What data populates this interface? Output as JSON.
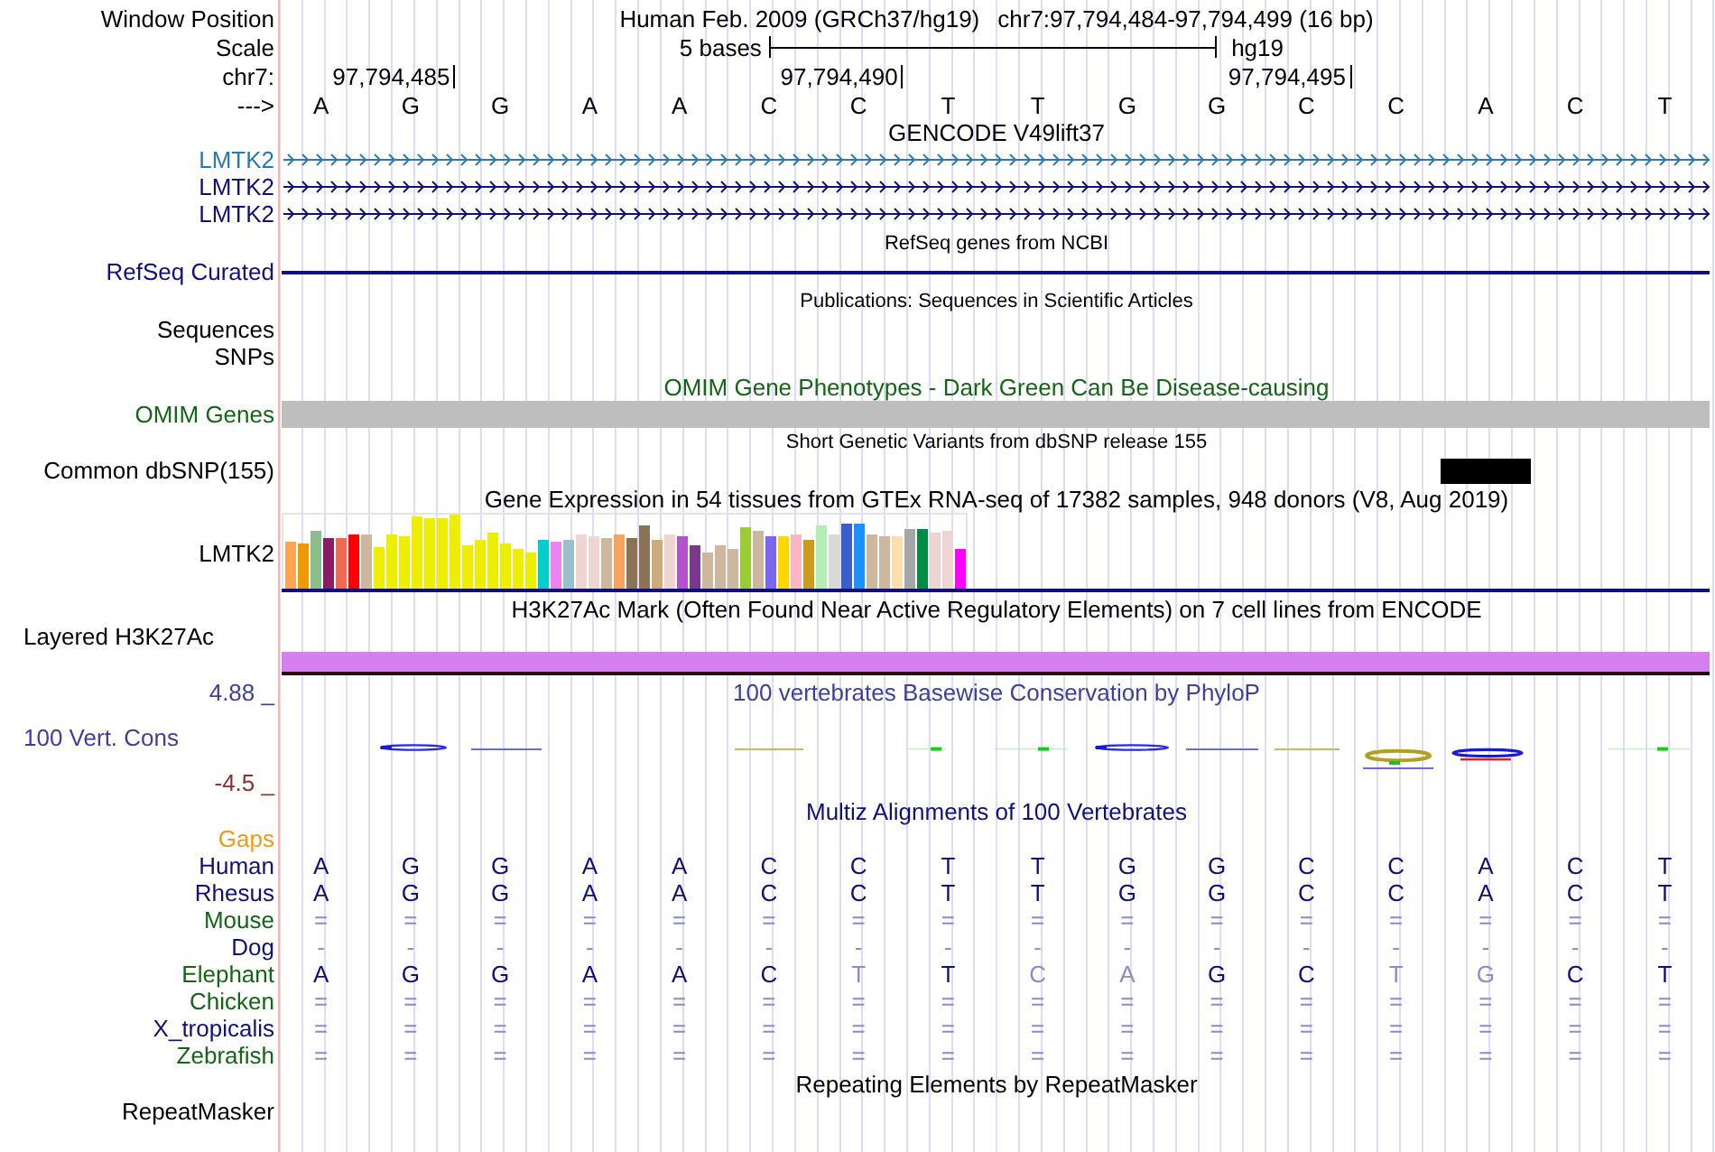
{
  "header": {
    "position_label": "Window Position",
    "assembly": "Human Feb. 2009 (GRCh37/hg19)",
    "position": "chr7:97,794,484-97,794,499 (16 bp)",
    "scale_label": "Scale",
    "scale_length": "5 bases",
    "scale_assembly": "hg19",
    "chrom_label": "chr7:",
    "strand_label": "--->"
  },
  "bases": [
    {
      "letter": "A"
    },
    {
      "letter": "G",
      "tick": "97,794,485"
    },
    {
      "letter": "G"
    },
    {
      "letter": "A"
    },
    {
      "letter": "A"
    },
    {
      "letter": "C"
    },
    {
      "letter": "C",
      "tick": "97,794,490"
    },
    {
      "letter": "T"
    },
    {
      "letter": "T"
    },
    {
      "letter": "G"
    },
    {
      "letter": "G"
    },
    {
      "letter": "C",
      "tick": "97,794,495"
    },
    {
      "letter": "C"
    },
    {
      "letter": "A"
    },
    {
      "letter": "C"
    },
    {
      "letter": "T"
    }
  ],
  "tracks": [
    {
      "kind": "genes",
      "title": "GENCODE V49lift37",
      "color": "#000000",
      "small_title": false,
      "rows": [
        {
          "label": "LMTK2",
          "color": "#2a78b4"
        },
        {
          "label": "LMTK2",
          "color": "#10107c"
        },
        {
          "label": "LMTK2",
          "color": "#10107c"
        }
      ]
    },
    {
      "kind": "line",
      "title": "RefSeq genes from NCBI",
      "color": "#000000",
      "small_title": true,
      "rows": [
        {
          "label": "RefSeq Curated",
          "color": "#10107c"
        }
      ]
    },
    {
      "kind": "empty",
      "title": "Publications: Sequences in Scientific Articles",
      "color": "#000000",
      "small_title": true,
      "rows": [
        {
          "label": "Sequences",
          "color": "#000000"
        },
        {
          "label": "SNPs",
          "color": "#000000"
        }
      ]
    },
    {
      "kind": "bar",
      "title": "OMIM Gene Phenotypes - Dark Green Can Be Disease-causing",
      "color": "#136613",
      "small_title": false,
      "rows": [
        {
          "label": "OMIM Genes",
          "color": "#136613"
        }
      ]
    },
    {
      "kind": "snp",
      "title": "Short Genetic Variants from dbSNP release 155",
      "color": "#000000",
      "small_title": true,
      "rows": [
        {
          "label": "Common dbSNP(155)",
          "color": "#000000"
        }
      ]
    },
    {
      "kind": "expression",
      "title": "Gene Expression in 54 tissues from GTEx RNA-seq of 17382 samples, 948 donors (V8, Aug 2019)",
      "color": "#000000",
      "small_title": false,
      "rows": [
        {
          "label": "LMTK2",
          "color": "#000000"
        }
      ]
    },
    {
      "kind": "signal",
      "title": "H3K27Ac Mark (Often Found Near Active Regulatory Elements) on 7 cell lines from ENCODE",
      "color": "#000000",
      "small_title": false,
      "rows": [
        {
          "label": "Layered H3K27Ac",
          "color": "#000000"
        }
      ]
    },
    {
      "kind": "conservation",
      "title": "100 vertebrates Basewise Conservation by PhyloP",
      "color": "#40409c",
      "small_title": false,
      "axis_max": "4.88 _",
      "axis_min": "-4.5 _",
      "rows": [
        {
          "label": "100 Vert. Cons",
          "color": "#40409c"
        }
      ]
    },
    {
      "kind": "alignment",
      "title": "Multiz Alignments of 100 Vertebrates",
      "color": "#10107c",
      "small_title": false,
      "rows": [
        {
          "label": "Gaps",
          "color": "#f29a16"
        },
        {
          "label": "Human",
          "color": "#10107c",
          "cells": [
            {
              "text": "A",
              "faded": false
            },
            {
              "text": "G",
              "faded": false
            },
            {
              "text": "G",
              "faded": false
            },
            {
              "text": "A",
              "faded": false
            },
            {
              "text": "A",
              "faded": false
            },
            {
              "text": "C",
              "faded": false
            },
            {
              "text": "C",
              "faded": false
            },
            {
              "text": "T",
              "faded": false
            },
            {
              "text": "T",
              "faded": false
            },
            {
              "text": "G",
              "faded": false
            },
            {
              "text": "G",
              "faded": false
            },
            {
              "text": "C",
              "faded": false
            },
            {
              "text": "C",
              "faded": false
            },
            {
              "text": "A",
              "faded": false
            },
            {
              "text": "C",
              "faded": false
            },
            {
              "text": "T",
              "faded": false
            }
          ]
        },
        {
          "label": "Rhesus",
          "color": "#10107c",
          "cells": [
            {
              "text": "A",
              "faded": false
            },
            {
              "text": "G",
              "faded": false
            },
            {
              "text": "G",
              "faded": false
            },
            {
              "text": "A",
              "faded": false
            },
            {
              "text": "A",
              "faded": false
            },
            {
              "text": "C",
              "faded": false
            },
            {
              "text": "C",
              "faded": false
            },
            {
              "text": "T",
              "faded": false
            },
            {
              "text": "T",
              "faded": false
            },
            {
              "text": "G",
              "faded": false
            },
            {
              "text": "G",
              "faded": false
            },
            {
              "text": "C",
              "faded": false
            },
            {
              "text": "C",
              "faded": false
            },
            {
              "text": "A",
              "faded": false
            },
            {
              "text": "C",
              "faded": false
            },
            {
              "text": "T",
              "faded": false
            }
          ]
        },
        {
          "label": "Mouse",
          "color": "#136613",
          "cells": [
            {
              "text": "=",
              "faded": true
            },
            {
              "text": "=",
              "faded": true
            },
            {
              "text": "=",
              "faded": true
            },
            {
              "text": "=",
              "faded": true
            },
            {
              "text": "=",
              "faded": true
            },
            {
              "text": "=",
              "faded": true
            },
            {
              "text": "=",
              "faded": true
            },
            {
              "text": "=",
              "faded": true
            },
            {
              "text": "=",
              "faded": true
            },
            {
              "text": "=",
              "faded": true
            },
            {
              "text": "=",
              "faded": true
            },
            {
              "text": "=",
              "faded": true
            },
            {
              "text": "=",
              "faded": true
            },
            {
              "text": "=",
              "faded": true
            },
            {
              "text": "=",
              "faded": true
            },
            {
              "text": "=",
              "faded": true
            }
          ]
        },
        {
          "label": "Dog",
          "color": "#10107c",
          "cells": [
            {
              "text": "-",
              "faded": true
            },
            {
              "text": "-",
              "faded": true
            },
            {
              "text": "-",
              "faded": true
            },
            {
              "text": "-",
              "faded": true
            },
            {
              "text": "-",
              "faded": true
            },
            {
              "text": "-",
              "faded": true
            },
            {
              "text": "-",
              "faded": true
            },
            {
              "text": "-",
              "faded": true
            },
            {
              "text": "-",
              "faded": true
            },
            {
              "text": "-",
              "faded": true
            },
            {
              "text": "-",
              "faded": true
            },
            {
              "text": "-",
              "faded": true
            },
            {
              "text": "-",
              "faded": true
            },
            {
              "text": "-",
              "faded": true
            },
            {
              "text": "-",
              "faded": true
            },
            {
              "text": "-",
              "faded": true
            }
          ]
        },
        {
          "label": "Elephant",
          "color": "#136613",
          "cells": [
            {
              "text": "A",
              "faded": false
            },
            {
              "text": "G",
              "faded": false
            },
            {
              "text": "G",
              "faded": false
            },
            {
              "text": "A",
              "faded": false
            },
            {
              "text": "A",
              "faded": false
            },
            {
              "text": "C",
              "faded": false
            },
            {
              "text": "T",
              "faded": true
            },
            {
              "text": "T",
              "faded": false
            },
            {
              "text": "C",
              "faded": true
            },
            {
              "text": "A",
              "faded": true
            },
            {
              "text": "G",
              "faded": false
            },
            {
              "text": "C",
              "faded": false
            },
            {
              "text": "T",
              "faded": true
            },
            {
              "text": "G",
              "faded": true
            },
            {
              "text": "C",
              "faded": false
            },
            {
              "text": "T",
              "faded": false
            }
          ]
        },
        {
          "label": "Chicken",
          "color": "#136613",
          "cells": [
            {
              "text": "=",
              "faded": true
            },
            {
              "text": "=",
              "faded": true
            },
            {
              "text": "=",
              "faded": true
            },
            {
              "text": "=",
              "faded": true
            },
            {
              "text": "=",
              "faded": true
            },
            {
              "text": "=",
              "faded": true
            },
            {
              "text": "=",
              "faded": true
            },
            {
              "text": "=",
              "faded": true
            },
            {
              "text": "=",
              "faded": true
            },
            {
              "text": "=",
              "faded": true
            },
            {
              "text": "=",
              "faded": true
            },
            {
              "text": "=",
              "faded": true
            },
            {
              "text": "=",
              "faded": true
            },
            {
              "text": "=",
              "faded": true
            },
            {
              "text": "=",
              "faded": true
            },
            {
              "text": "=",
              "faded": true
            }
          ]
        },
        {
          "label": "X_tropicalis",
          "color": "#10107c",
          "cells": [
            {
              "text": "=",
              "faded": true
            },
            {
              "text": "=",
              "faded": true
            },
            {
              "text": "=",
              "faded": true
            },
            {
              "text": "=",
              "faded": true
            },
            {
              "text": "=",
              "faded": true
            },
            {
              "text": "=",
              "faded": true
            },
            {
              "text": "=",
              "faded": true
            },
            {
              "text": "=",
              "faded": true
            },
            {
              "text": "=",
              "faded": true
            },
            {
              "text": "=",
              "faded": true
            },
            {
              "text": "=",
              "faded": true
            },
            {
              "text": "=",
              "faded": true
            },
            {
              "text": "=",
              "faded": true
            },
            {
              "text": "=",
              "faded": true
            },
            {
              "text": "=",
              "faded": true
            },
            {
              "text": "=",
              "faded": true
            }
          ]
        },
        {
          "label": "Zebrafish",
          "color": "#136613",
          "cells": [
            {
              "text": "=",
              "faded": true
            },
            {
              "text": "=",
              "faded": true
            },
            {
              "text": "=",
              "faded": true
            },
            {
              "text": "=",
              "faded": true
            },
            {
              "text": "=",
              "faded": true
            },
            {
              "text": "=",
              "faded": true
            },
            {
              "text": "=",
              "faded": true
            },
            {
              "text": "=",
              "faded": true
            },
            {
              "text": "=",
              "faded": true
            },
            {
              "text": "=",
              "faded": true
            },
            {
              "text": "=",
              "faded": true
            },
            {
              "text": "=",
              "faded": true
            },
            {
              "text": "=",
              "faded": true
            },
            {
              "text": "=",
              "faded": true
            },
            {
              "text": "=",
              "faded": true
            },
            {
              "text": "=",
              "faded": true
            }
          ]
        }
      ]
    },
    {
      "kind": "empty",
      "title": "Repeating Elements by RepeatMasker",
      "color": "#000000",
      "small_title": false,
      "rows": [
        {
          "label": "RepeatMasker",
          "color": "#000000"
        }
      ]
    }
  ]
}
